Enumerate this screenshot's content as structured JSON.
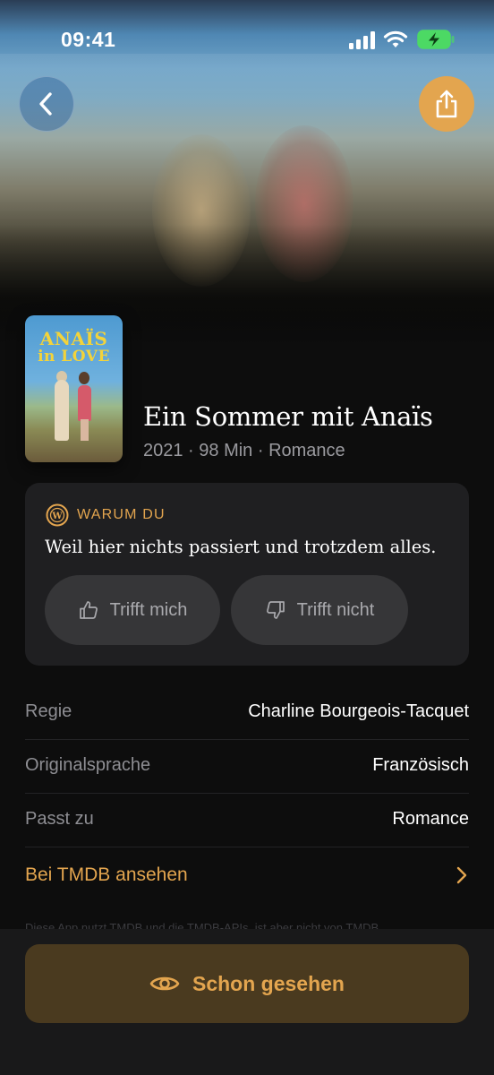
{
  "status_bar": {
    "time": "09:41"
  },
  "icons": {
    "back": "chevron-left-icon",
    "share": "share-icon",
    "why": "watch-logo-icon",
    "thumbs_up": "thumbs-up-icon",
    "thumbs_down": "thumbs-down-icon",
    "chevron": "chevron-right-icon",
    "eye": "eye-icon"
  },
  "colors": {
    "accent": "#e3a54f",
    "background": "#0d0d0d",
    "card": "#1f1f21",
    "pill": "#363638",
    "seen_button": "#4a3a1f"
  },
  "poster": {
    "title_line1": "ANAÏS",
    "title_line2": "in LOVE"
  },
  "movie": {
    "title": "Ein Sommer mit Anaïs",
    "meta": "2021 · 98 Min · Romance"
  },
  "why": {
    "label": "WARUM DU",
    "text": "Weil hier nichts passiert und trotzdem alles.",
    "yes_label": "Trifft mich",
    "no_label": "Trifft nicht"
  },
  "info": [
    {
      "label": "Regie",
      "value": "Charline Bourgeois-Tacquet"
    },
    {
      "label": "Originalsprache",
      "value": "Französisch"
    },
    {
      "label": "Passt zu",
      "value": "Romance"
    }
  ],
  "tmdb": {
    "label": "Bei TMDB ansehen"
  },
  "attribution": "Diese App nutzt TMDB und die TMDB-APIs, ist aber nicht von TMDB",
  "seen_button": {
    "label": "Schon gesehen"
  }
}
